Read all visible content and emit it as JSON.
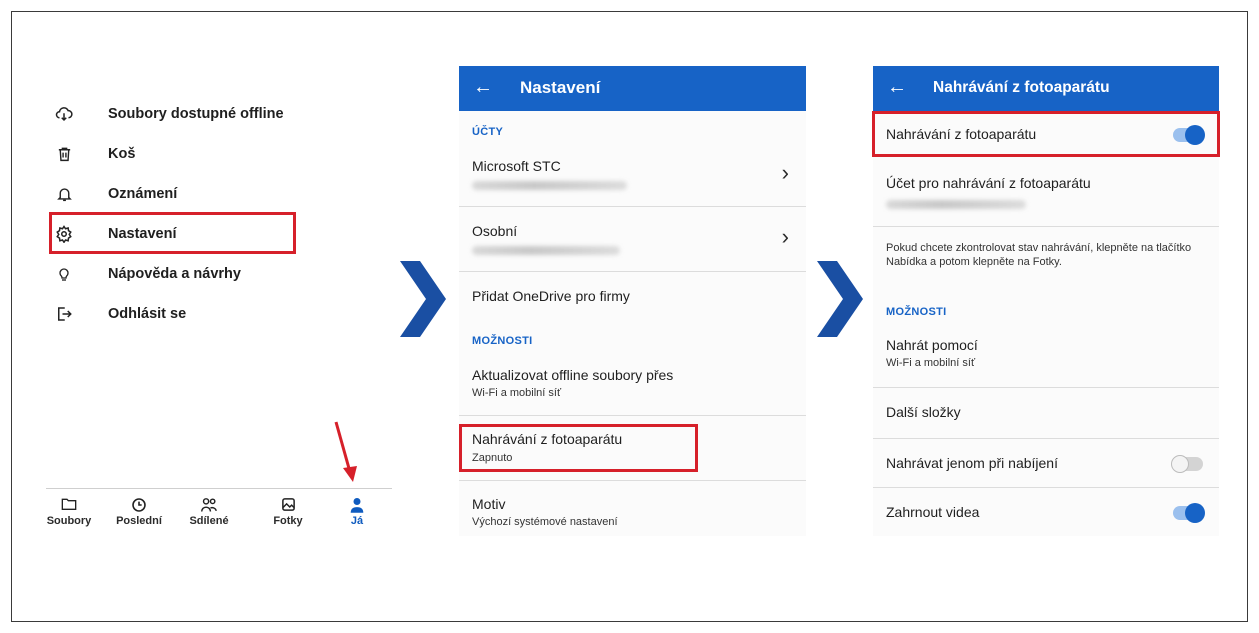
{
  "menu": {
    "items": [
      {
        "label": "Soubory dostupné offline",
        "icon": "cloud-download-icon"
      },
      {
        "label": "Koš",
        "icon": "trash-icon"
      },
      {
        "label": "Oznámení",
        "icon": "bell-icon"
      },
      {
        "label": "Nastavení",
        "icon": "gear-icon"
      },
      {
        "label": "Nápověda a návrhy",
        "icon": "lightbulb-icon"
      },
      {
        "label": "Odhlásit se",
        "icon": "sign-out-icon"
      }
    ],
    "tabs": [
      {
        "label": "Soubory",
        "icon": "folder-icon"
      },
      {
        "label": "Poslední",
        "icon": "clock-icon"
      },
      {
        "label": "Sdílené",
        "icon": "people-icon"
      },
      {
        "label": "Fotky",
        "icon": "photo-icon"
      },
      {
        "label": "Já",
        "icon": "person-icon"
      }
    ]
  },
  "settings": {
    "title": "Nastavení",
    "section_accounts": "ÚČTY",
    "account1": "Microsoft STC",
    "account2": "Osobní",
    "add_business": "Přidat OneDrive pro firmy",
    "section_options": "MOŽNOSTI",
    "update_offline": {
      "title": "Aktualizovat offline soubory přes",
      "value": "Wi-Fi a mobilní síť"
    },
    "camera_upload": {
      "title": "Nahrávání z fotoaparátu",
      "value": "Zapnuto"
    },
    "theme": {
      "title": "Motiv",
      "value": "Výchozí systémové nastavení"
    }
  },
  "camera": {
    "title": "Nahrávání z fotoaparátu",
    "toggle_label": "Nahrávání z fotoaparátu",
    "account_label": "Účet pro nahrávání z fotoaparátu",
    "note": "Pokud chcete zkontrolovat stav nahrávání, klepněte na tlačítko Nabídka a potom klepněte na Fotky.",
    "section_options": "MOŽNOSTI",
    "upload_via": {
      "title": "Nahrát pomocí",
      "value": "Wi-Fi a mobilní síť"
    },
    "more_folders": "Další složky",
    "charging_only": "Nahrávat jenom při nabíjení",
    "include_videos": "Zahrnout videa",
    "toggles": {
      "camera_upload": true,
      "charging_only": false,
      "include_videos": true
    }
  },
  "colors": {
    "accent": "#1763c6",
    "highlight": "#d6202a",
    "chevron": "#1a4fa3"
  }
}
